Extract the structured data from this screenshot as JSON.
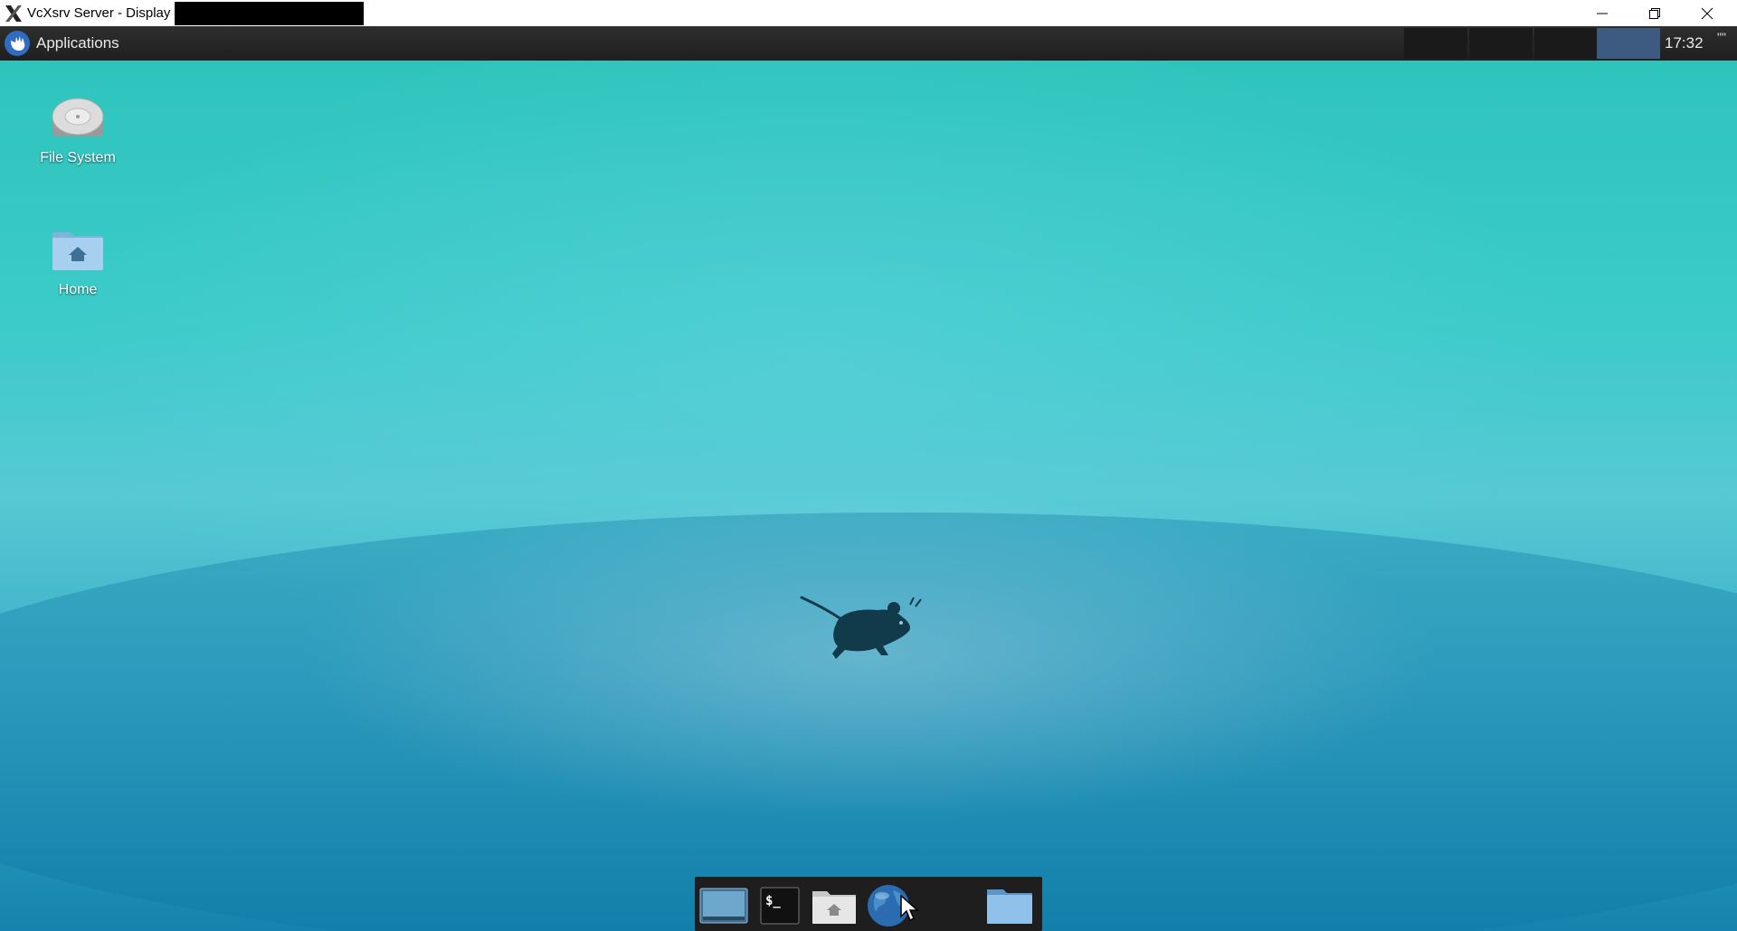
{
  "window": {
    "title": "VcXsrv Server - Display"
  },
  "panel": {
    "applications_label": "Applications",
    "clock": "17:32",
    "overflow_label": "\"\""
  },
  "desktop": {
    "icons": [
      {
        "label": "File System"
      },
      {
        "label": "Home"
      }
    ]
  },
  "dock": {
    "items": [
      "show-desktop",
      "terminal",
      "home-folder",
      "web-browser",
      "file-manager"
    ]
  },
  "colors": {
    "panel_bg": "#222222",
    "active_workspace": "#3d5a80",
    "desktop_top": "#2ec4bc",
    "desktop_bottom": "#1583ad",
    "dock_bg": "#1e1e1e"
  }
}
